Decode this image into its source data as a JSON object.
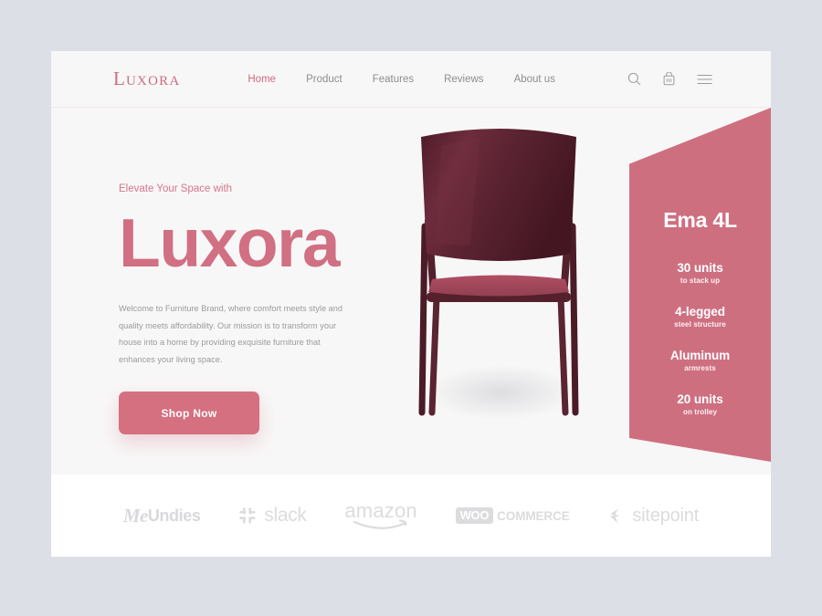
{
  "brand": {
    "logo": "Luxora"
  },
  "nav": {
    "items": [
      {
        "label": "Home",
        "active": true
      },
      {
        "label": "Product",
        "active": false
      },
      {
        "label": "Features",
        "active": false
      },
      {
        "label": "Reviews",
        "active": false
      },
      {
        "label": "About us",
        "active": false
      }
    ],
    "icons": [
      "search-icon",
      "shopping-basket-icon",
      "hamburger-menu-icon"
    ]
  },
  "hero": {
    "eyebrow": "Elevate Your Space with",
    "headline": "Luxora",
    "paragraph": "Welcome to Furniture Brand, where comfort meets style and quality meets affordability. Our mission is to transform your house into a home by providing exquisite furniture that enhances your living space.",
    "cta_label": "Shop Now",
    "product_image": "burgundy-stacking-chair"
  },
  "spec_panel": {
    "title": "Ema 4L",
    "specs": [
      {
        "main": "30 units",
        "sub": "to stack up"
      },
      {
        "main": "4-legged",
        "sub": "steel structure"
      },
      {
        "main": "Aluminum",
        "sub": "armrests"
      },
      {
        "main": "20 units",
        "sub": "on trolley"
      }
    ]
  },
  "footer": {
    "brands": [
      {
        "name": "MeUndies",
        "part1": "Me",
        "part2": "Undies"
      },
      {
        "name": "slack",
        "text": "slack"
      },
      {
        "name": "amazon",
        "text": "amazon"
      },
      {
        "name": "WooCommerce",
        "badge": "WOO",
        "text": "COMMERCE"
      },
      {
        "name": "sitepoint",
        "text": "sitepoint"
      }
    ]
  },
  "colors": {
    "page_background": "#dddfe6",
    "card_background": "#f8f7f7",
    "accent_pink": "#ce6f80",
    "headline_pink": "#d16f83",
    "chair_frame": "#5a2030",
    "chair_seat": "#a8485c",
    "footer_background": "#ffffff",
    "logo_grey": "#dcdcde"
  }
}
